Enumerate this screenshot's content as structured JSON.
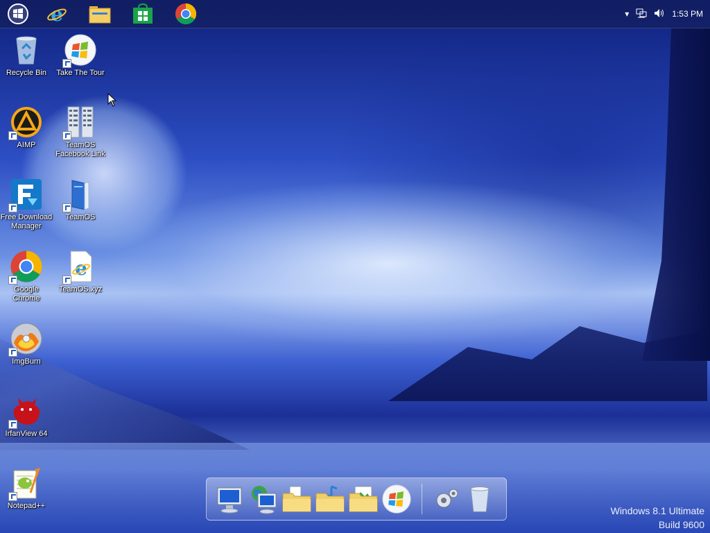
{
  "taskbar": {
    "pinned": [
      {
        "name": "start-button",
        "icon": "windows-logo-icon"
      },
      {
        "name": "internet-explorer",
        "icon": "ie-icon"
      },
      {
        "name": "file-explorer",
        "icon": "folder-icon"
      },
      {
        "name": "store",
        "icon": "store-icon"
      },
      {
        "name": "google-chrome",
        "icon": "chrome-icon"
      }
    ],
    "clock": "1:53 PM"
  },
  "desktop": {
    "icons": [
      {
        "label": "Recycle Bin"
      },
      {
        "label": "Take The Tour"
      },
      {
        "label": "AIMP"
      },
      {
        "label": "TeamOS Facebook Link"
      },
      {
        "label": "Free Download Manager"
      },
      {
        "label": "TeamOS"
      },
      {
        "label": "Google Chrome"
      },
      {
        "label": "TeamOS.xyz"
      },
      {
        "label": "ImgBurn"
      },
      {
        "label": "IrfanView 64"
      },
      {
        "label": "Notepad++"
      }
    ]
  },
  "dock": {
    "items": [
      "computer-icon",
      "network-icon",
      "documents-folder-icon",
      "music-folder-icon",
      "pictures-folder-icon",
      "windows-orb-icon",
      "settings-gear-icon",
      "recycle-bin-icon"
    ]
  },
  "watermark": {
    "line1": "Windows 8.1 Ultimate",
    "line2": "Build 9600"
  },
  "colors": {
    "sky_dark": "#0e1f7a",
    "sky_light": "#aac2f3",
    "chrome_red": "#db4437",
    "chrome_green": "#0f9d58",
    "chrome_yellow": "#f4b400",
    "chrome_blue": "#4285f4"
  }
}
